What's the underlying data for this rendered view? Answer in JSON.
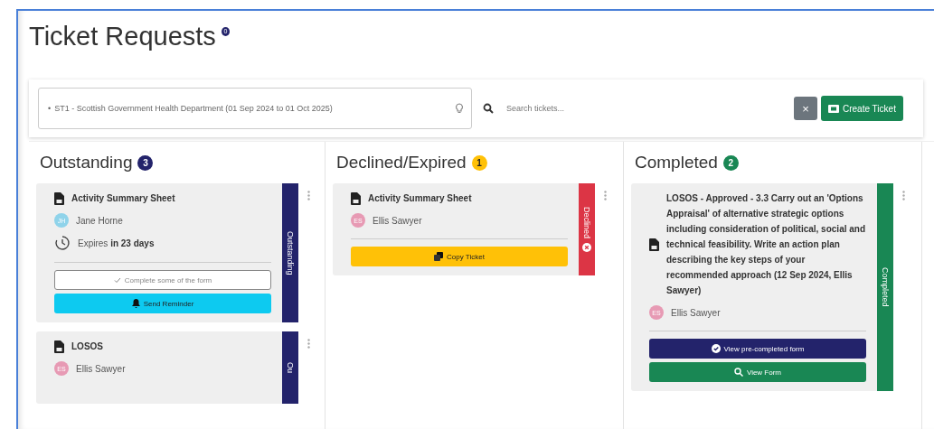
{
  "page": {
    "title": "Ticket Requests",
    "info_badge": "0"
  },
  "filters": {
    "tag_bullet": "•",
    "selected_tag": "ST1 - Scottish Government Health Department (01 Sep 2024 to 01 Oct 2025)",
    "search": {
      "placeholder": "Search tickets..."
    },
    "clear_button": "×",
    "create_button": "Create Ticket"
  },
  "columns": [
    {
      "kind": "outstanding",
      "title": "Outstanding",
      "count": "3",
      "cards": [
        {
          "title": "Activity Summary Sheet",
          "person": {
            "initials": "JH",
            "name": "Jane Horne",
            "color": "#8fd3ea"
          },
          "expiry": {
            "prefix": "Expires",
            "value": "in 23 days"
          },
          "status": "Outstanding",
          "buttons": [
            {
              "kind": "partial",
              "label": "Complete some of the form"
            },
            {
              "kind": "reminder",
              "label": "Send Reminder"
            }
          ]
        },
        {
          "title": "LOSOS",
          "person": {
            "initials": "ES",
            "name": "Ellis Sawyer",
            "color": "#e79ab4"
          },
          "status": "Ou"
        }
      ]
    },
    {
      "kind": "declined",
      "title": "Declined/Expired",
      "count": "1",
      "cards": [
        {
          "title": "Activity Summary Sheet",
          "person": {
            "initials": "ES",
            "name": "Ellis Sawyer",
            "color": "#e79ab4"
          },
          "status": "Declined",
          "buttons": [
            {
              "kind": "copy",
              "label": "Copy Ticket"
            }
          ]
        }
      ]
    },
    {
      "kind": "completed",
      "title": "Completed",
      "count": "2",
      "cards": [
        {
          "title": "LOSOS - Approved - 3.3 Carry out an 'Options Appraisal' of alternative strategic options including consideration of political, social and technical feasibility. Write an action plan describing the key steps of your recommended approach (12 Sep 2024, Ellis Sawyer)",
          "person": {
            "initials": "ES",
            "name": "Ellis Sawyer",
            "color": "#e79ab4"
          },
          "status": "Completed",
          "buttons": [
            {
              "kind": "precompleted",
              "label": "View pre-completed form"
            },
            {
              "kind": "view",
              "label": "View Form"
            }
          ]
        }
      ]
    }
  ]
}
